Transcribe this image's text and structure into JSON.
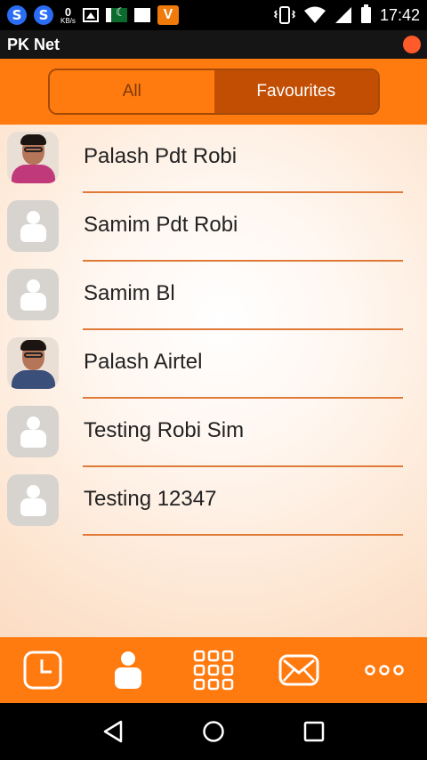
{
  "status_bar": {
    "icons": [
      "s-app-icon",
      "s-app-icon",
      "data-speed-icon",
      "image-icon",
      "pakistan-flag-icon",
      "square-icon",
      "vimeo-icon"
    ],
    "speed_value": "0",
    "speed_unit": "KB/s",
    "vimeo_letter": "V",
    "s_letter": "S",
    "right_icons": [
      "vibrate-icon",
      "wifi-icon",
      "signal-icon",
      "battery-icon"
    ],
    "time": "17:42"
  },
  "app_bar": {
    "title": "PK Net",
    "status_dot_color": "#ff5a2a"
  },
  "tabs": {
    "all_label": "All",
    "favourites_label": "Favourites",
    "selected": "Favourites"
  },
  "contacts": [
    {
      "name": "Palash Pdt Robi",
      "avatar": "photo"
    },
    {
      "name": "Samim Pdt Robi",
      "avatar": "generic"
    },
    {
      "name": "Samim Bl",
      "avatar": "generic"
    },
    {
      "name": "Palash Airtel",
      "avatar": "photo"
    },
    {
      "name": "Testing Robi Sim",
      "avatar": "generic"
    },
    {
      "name": "Testing 12347",
      "avatar": "generic"
    }
  ],
  "bottom_nav": {
    "items": [
      "history-icon",
      "contacts-icon",
      "dialpad-icon",
      "messages-icon",
      "more-icon"
    ],
    "selected": "contacts-icon"
  },
  "system_nav": {
    "items": [
      "back-icon",
      "home-icon",
      "recents-icon"
    ]
  },
  "colors": {
    "accent": "#ff7a0f",
    "tab_selected": "#c24e04",
    "divider": "#e07a38"
  }
}
